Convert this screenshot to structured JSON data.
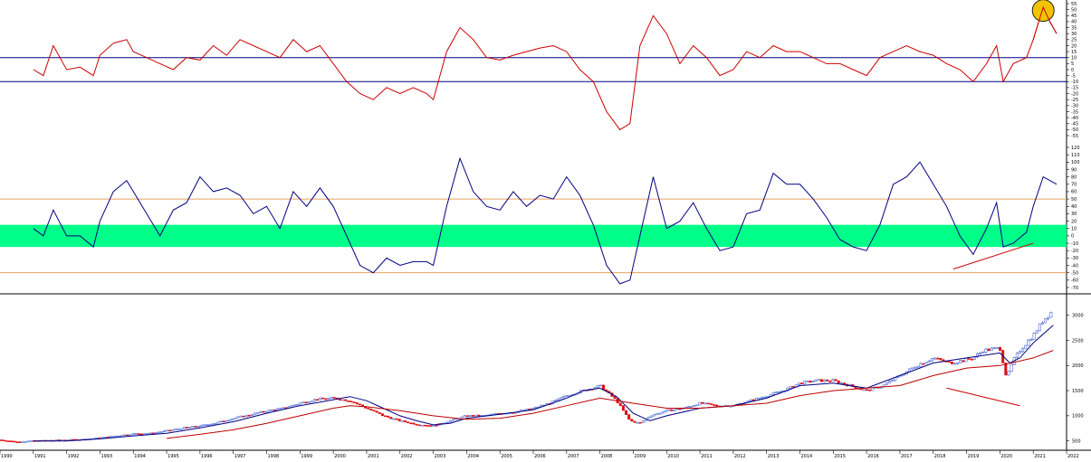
{
  "chart_data": [
    {
      "type": "line",
      "panel": "top oscillator",
      "y_ticks": [
        55,
        50,
        45,
        40,
        35,
        30,
        25,
        20,
        15,
        10,
        5,
        0,
        -5,
        -10,
        -15,
        -20,
        -25,
        -30,
        -35,
        -40,
        -45,
        -50,
        -55
      ],
      "ylim": [
        -55,
        55
      ],
      "reference_lines": [
        10,
        -10
      ],
      "highlight_marker": {
        "x": 2021.3,
        "y": 50,
        "color": "#f2c300"
      },
      "colors": {
        "series": "#cc0000",
        "reference": "#000080"
      },
      "series": [
        {
          "x": [
            1991.0,
            1991.3,
            1991.6,
            1992.0,
            1992.4,
            1992.8,
            1993.0,
            1993.4,
            1993.8,
            1994.0,
            1994.4,
            1994.8,
            1995.2,
            1995.6,
            1996.0,
            1996.4,
            1996.8,
            1997.2,
            1997.6,
            1998.0,
            1998.4,
            1998.8,
            1999.2,
            1999.6,
            2000.0,
            2000.4,
            2000.8,
            2001.2,
            2001.6,
            2002.0,
            2002.4,
            2002.8,
            2003.0,
            2003.4,
            2003.8,
            2004.2,
            2004.6,
            2005.0,
            2005.4,
            2005.8,
            2006.2,
            2006.6,
            2007.0,
            2007.4,
            2007.8,
            2008.2,
            2008.6,
            2008.9,
            2009.2,
            2009.6,
            2010.0,
            2010.4,
            2010.8,
            2011.2,
            2011.6,
            2012.0,
            2012.4,
            2012.8,
            2013.2,
            2013.6,
            2014.0,
            2014.4,
            2014.8,
            2015.2,
            2015.6,
            2016.0,
            2016.4,
            2016.8,
            2017.2,
            2017.6,
            2018.0,
            2018.4,
            2018.8,
            2019.2,
            2019.6,
            2019.9,
            2020.1,
            2020.4,
            2020.8,
            2021.0,
            2021.3,
            2021.5,
            2021.7
          ],
          "y": [
            0,
            -5,
            20,
            0,
            2,
            -5,
            12,
            22,
            25,
            15,
            10,
            5,
            0,
            10,
            8,
            20,
            12,
            25,
            20,
            15,
            10,
            25,
            15,
            20,
            5,
            -10,
            -20,
            -25,
            -15,
            -20,
            -15,
            -20,
            -25,
            15,
            35,
            25,
            10,
            8,
            12,
            15,
            18,
            20,
            15,
            0,
            -10,
            -35,
            -50,
            -45,
            20,
            45,
            30,
            5,
            20,
            10,
            -5,
            0,
            15,
            10,
            20,
            15,
            15,
            10,
            5,
            5,
            0,
            -5,
            10,
            15,
            20,
            15,
            12,
            5,
            0,
            -10,
            5,
            20,
            -10,
            5,
            10,
            25,
            52,
            40,
            30
          ]
        }
      ]
    },
    {
      "type": "line",
      "panel": "middle oscillator",
      "y_ticks": [
        120,
        110,
        100,
        90,
        80,
        70,
        60,
        50,
        40,
        30,
        20,
        10,
        0,
        -10,
        -20,
        -30,
        -40,
        -50,
        -60,
        -70
      ],
      "ylim": [
        -70,
        120
      ],
      "reference_lines": [
        50,
        -50
      ],
      "shaded_band": [
        -15,
        15
      ],
      "trendline": {
        "x": [
          2018.6,
          2021.0
        ],
        "y": [
          -45,
          -10
        ]
      },
      "colors": {
        "series": "#000080",
        "band": "#00ff88",
        "reference": "#e8a060",
        "trendline": "#cc0000"
      },
      "series": [
        {
          "x": [
            1991.0,
            1991.3,
            1991.6,
            1992.0,
            1992.4,
            1992.8,
            1993.0,
            1993.4,
            1993.8,
            1994.0,
            1994.4,
            1994.8,
            1995.2,
            1995.6,
            1996.0,
            1996.4,
            1996.8,
            1997.2,
            1997.6,
            1998.0,
            1998.4,
            1998.8,
            1999.2,
            1999.6,
            2000.0,
            2000.4,
            2000.8,
            2001.2,
            2001.6,
            2002.0,
            2002.4,
            2002.8,
            2003.0,
            2003.4,
            2003.8,
            2004.2,
            2004.6,
            2005.0,
            2005.4,
            2005.8,
            2006.2,
            2006.6,
            2007.0,
            2007.4,
            2007.8,
            2008.2,
            2008.6,
            2008.9,
            2009.2,
            2009.6,
            2010.0,
            2010.4,
            2010.8,
            2011.2,
            2011.6,
            2012.0,
            2012.4,
            2012.8,
            2013.2,
            2013.6,
            2014.0,
            2014.4,
            2014.8,
            2015.2,
            2015.6,
            2016.0,
            2016.4,
            2016.8,
            2017.2,
            2017.6,
            2018.0,
            2018.4,
            2018.8,
            2019.2,
            2019.6,
            2019.9,
            2020.1,
            2020.4,
            2020.8,
            2021.0,
            2021.3,
            2021.5,
            2021.7
          ],
          "y": [
            10,
            0,
            35,
            0,
            0,
            -15,
            20,
            60,
            75,
            60,
            30,
            0,
            35,
            45,
            80,
            60,
            65,
            55,
            30,
            40,
            10,
            60,
            40,
            65,
            40,
            0,
            -40,
            -50,
            -30,
            -40,
            -35,
            -35,
            -40,
            40,
            105,
            60,
            40,
            35,
            60,
            40,
            55,
            50,
            80,
            55,
            15,
            -40,
            -65,
            -60,
            0,
            80,
            10,
            20,
            45,
            10,
            -20,
            -15,
            30,
            35,
            85,
            70,
            70,
            50,
            25,
            -5,
            -15,
            -20,
            15,
            70,
            80,
            100,
            70,
            40,
            0,
            -25,
            10,
            45,
            -15,
            -10,
            5,
            40,
            80,
            75,
            70
          ]
        }
      ]
    },
    {
      "type": "line",
      "panel": "price",
      "x_ticks": [
        "1990",
        "1991",
        "1992",
        "1993",
        "1994",
        "1995",
        "1996",
        "1997",
        "1998",
        "1999",
        "2000",
        "2001",
        "2002",
        "2003",
        "2004",
        "2005",
        "2006",
        "2007",
        "2008",
        "2009",
        "2010",
        "2011",
        "2012",
        "2013",
        "2014",
        "2015",
        "2016",
        "2017",
        "2018",
        "2019",
        "2020",
        "2021",
        "2022"
      ],
      "xlim": [
        1990,
        2022
      ],
      "y_ticks": [
        3000,
        2500,
        2000,
        1500,
        1000,
        500
      ],
      "ylim": [
        350,
        3300
      ],
      "trendline": {
        "x": [
          2018.4,
          2020.6
        ],
        "y": [
          1550,
          1200
        ]
      },
      "colors": {
        "price": "#000080",
        "up": "#4a6bd8",
        "down": "#dd1111",
        "fast_ma": "#000080",
        "slow_ma": "#bb0000",
        "trendline": "#cc0000"
      },
      "series": [
        {
          "name": "",
          "x": [
            1990.0,
            1990.5,
            1991.0,
            1991.5,
            1992.0,
            1992.5,
            1993.0,
            1993.5,
            1994.0,
            1994.5,
            1995.0,
            1995.5,
            1996.0,
            1996.5,
            1997.0,
            1997.5,
            1998.0,
            1998.5,
            1999.0,
            1999.5,
            2000.0,
            2000.5,
            2001.0,
            2001.5,
            2002.0,
            2002.5,
            2003.0,
            2003.5,
            2004.0,
            2004.5,
            2005.0,
            2005.5,
            2006.0,
            2006.5,
            2007.0,
            2007.5,
            2008.0,
            2008.5,
            2008.9,
            2009.2,
            2009.5,
            2010.0,
            2010.5,
            2011.0,
            2011.5,
            2012.0,
            2012.5,
            2013.0,
            2013.5,
            2014.0,
            2014.5,
            2015.0,
            2015.5,
            2016.0,
            2016.5,
            2017.0,
            2017.5,
            2018.0,
            2018.5,
            2018.9,
            2019.2,
            2019.5,
            2020.0,
            2020.2,
            2020.4,
            2020.6,
            2021.0,
            2021.3,
            2021.6
          ],
          "y": [
            520,
            480,
            500,
            510,
            520,
            530,
            560,
            600,
            640,
            650,
            700,
            760,
            800,
            860,
            950,
            1020,
            1100,
            1150,
            1250,
            1330,
            1350,
            1300,
            1150,
            1000,
            900,
            830,
            800,
            900,
            1000,
            1000,
            1050,
            1080,
            1150,
            1250,
            1400,
            1500,
            1600,
            1300,
            900,
            850,
            1000,
            1100,
            1150,
            1250,
            1200,
            1200,
            1300,
            1400,
            1500,
            1650,
            1700,
            1700,
            1600,
            1500,
            1600,
            1800,
            2000,
            2150,
            2050,
            2100,
            2150,
            2300,
            2350,
            1750,
            2100,
            2300,
            2600,
            2900,
            3100
          ]
        },
        {
          "name": "",
          "x": [
            1991.0,
            1992.0,
            1993.0,
            1994.0,
            1995.0,
            1996.0,
            1997.0,
            1998.0,
            1999.0,
            2000.0,
            2000.5,
            2001.0,
            2001.5,
            2002.0,
            2002.5,
            2003.0,
            2003.5,
            2004.0,
            2005.0,
            2006.0,
            2007.0,
            2007.5,
            2008.0,
            2008.5,
            2009.0,
            2009.5,
            2010.0,
            2011.0,
            2012.0,
            2013.0,
            2014.0,
            2015.0,
            2016.0,
            2017.0,
            2018.0,
            2019.0,
            2020.0,
            2020.3,
            2020.6,
            2021.0,
            2021.6
          ],
          "y": [
            500,
            500,
            540,
            600,
            650,
            760,
            880,
            1050,
            1200,
            1320,
            1380,
            1300,
            1150,
            1000,
            900,
            820,
            850,
            950,
            1030,
            1120,
            1350,
            1500,
            1550,
            1380,
            1050,
            900,
            1000,
            1150,
            1200,
            1350,
            1600,
            1650,
            1550,
            1800,
            2050,
            2150,
            2250,
            2050,
            2150,
            2450,
            2800
          ]
        },
        {
          "name": "",
          "x": [
            1995.0,
            1996.0,
            1997.0,
            1998.0,
            1999.0,
            2000.0,
            2000.5,
            2001.0,
            2002.0,
            2003.0,
            2004.0,
            2005.0,
            2006.0,
            2007.0,
            2008.0,
            2009.0,
            2010.0,
            2011.0,
            2012.0,
            2013.0,
            2014.0,
            2015.0,
            2016.0,
            2017.0,
            2018.0,
            2019.0,
            2020.0,
            2021.0,
            2021.6
          ],
          "y": [
            550,
            630,
            720,
            850,
            1000,
            1150,
            1200,
            1180,
            1100,
            1000,
            930,
            950,
            1050,
            1200,
            1350,
            1250,
            1150,
            1150,
            1200,
            1250,
            1400,
            1500,
            1550,
            1600,
            1800,
            1950,
            2000,
            2150,
            2300
          ]
        }
      ]
    }
  ]
}
